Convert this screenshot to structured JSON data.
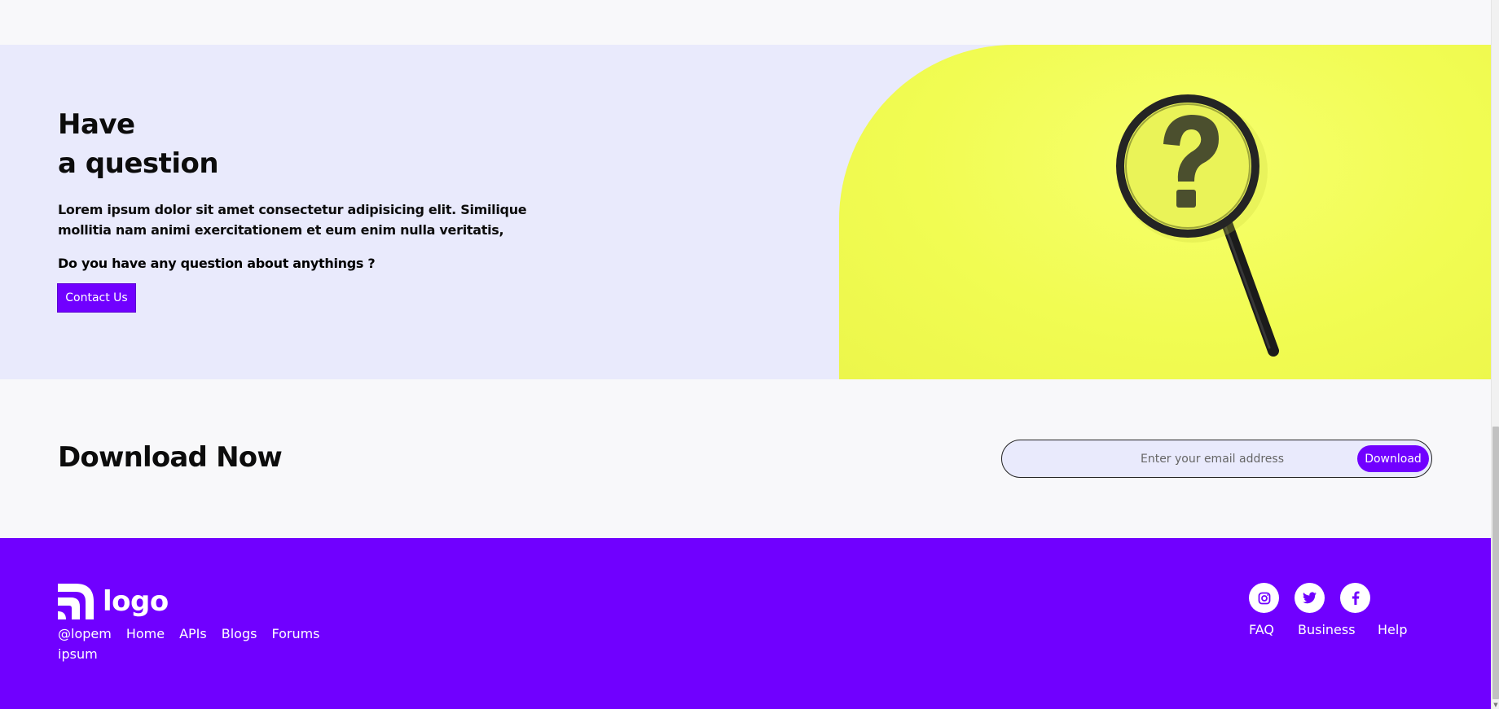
{
  "question": {
    "title_line1": "Have",
    "title_line2": "a question",
    "body": "Lorem ipsum dolor sit amet consectetur adipisicing elit. Similique mollitia nam animi exercitationem et eum enim nulla veritatis,",
    "subtitle": "Do you have any question about anythings ?",
    "contact_label": "Contact Us",
    "image_icon": "magnifying-glass-question-icon"
  },
  "download": {
    "title": "Download Now",
    "email_placeholder": "Enter your email address",
    "button_label": "Download"
  },
  "footer": {
    "logo_text": "logo",
    "links": [
      "@lopem",
      "Home",
      "APIs",
      "Blogs",
      "Forums",
      "ipsum"
    ],
    "social_icons": [
      "instagram-icon",
      "twitter-icon",
      "facebook-icon"
    ],
    "right_links": [
      "FAQ",
      "Business",
      "Help"
    ]
  },
  "colors": {
    "accent": "#7000ff",
    "question_bg": "#e9eafc",
    "photo_bg": "#f2fe54",
    "page_bg": "#f8f8fa"
  }
}
